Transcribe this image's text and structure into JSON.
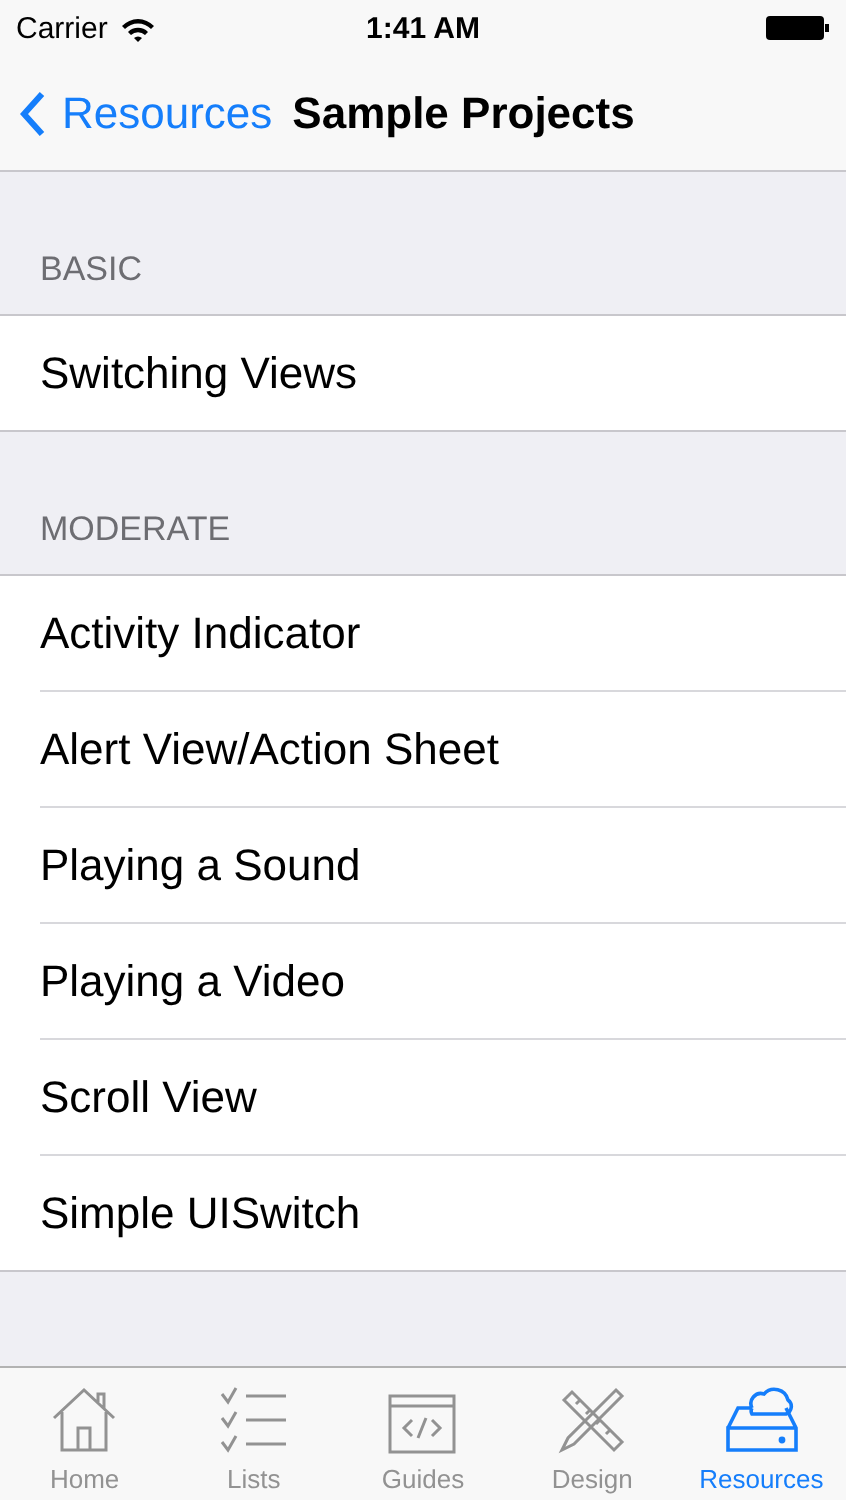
{
  "status_bar": {
    "carrier": "Carrier",
    "time": "1:41 AM"
  },
  "nav_bar": {
    "back": "Resources",
    "title": "Sample Projects"
  },
  "sections": [
    {
      "header": "BASIC",
      "items": [
        "Switching Views"
      ]
    },
    {
      "header": "MODERATE",
      "items": [
        "Activity Indicator",
        "Alert View/Action Sheet",
        "Playing a Sound",
        "Playing a Video",
        "Scroll View",
        "Simple UISwitch"
      ]
    }
  ],
  "tab_bar": [
    {
      "label": "Home",
      "selected": false
    },
    {
      "label": "Lists",
      "selected": false
    },
    {
      "label": "Guides",
      "selected": false
    },
    {
      "label": "Design",
      "selected": false
    },
    {
      "label": "Resources",
      "selected": true
    }
  ]
}
